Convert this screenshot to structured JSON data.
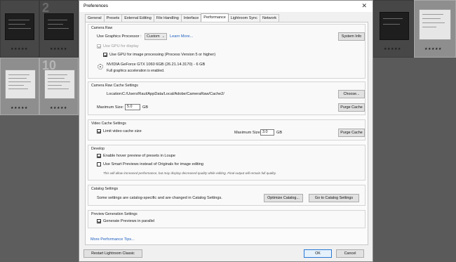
{
  "background": {
    "grid_numbers": [
      "2",
      "10"
    ],
    "stars": "★★★★★"
  },
  "dialog": {
    "title": "Preferences",
    "close_glyph": "✕",
    "tabs": [
      {
        "label": "General"
      },
      {
        "label": "Presets"
      },
      {
        "label": "External Editing"
      },
      {
        "label": "File Handling"
      },
      {
        "label": "Interface"
      },
      {
        "label": "Performance"
      },
      {
        "label": "Lightroom Sync"
      },
      {
        "label": "Network"
      }
    ],
    "active_tab": "Performance",
    "camera_raw": {
      "title": "Camera Raw",
      "gpu_label": "Use Graphics Processor :",
      "gpu_value": "Custom",
      "learn_more": "Learn More...",
      "system_info": "System Info",
      "gpu_display": "Use GPU for display",
      "gpu_display_checked": true,
      "gpu_image": "Use GPU for image processing (Process Version 5 or higher)",
      "gpu_image_checked": true,
      "gpu_name": "NVIDIA GeForce GTX 1060 6GB (26.21.14.3170) - 6 GB",
      "gpu_status": "Full graphics acceleration is enabled."
    },
    "cache": {
      "title": "Camera Raw Cache Settings",
      "location_label": "Location:",
      "location_value": "C:/Users/Raul/AppData/Local/Adobe/CameraRaw/Cache2/",
      "choose": "Choose...",
      "max_label": "Maximum Size:",
      "max_value": "5.0",
      "unit": "GB",
      "purge": "Purge Cache"
    },
    "video": {
      "title": "Video Cache Settings",
      "limit_label": "Limit video cache size",
      "limit_checked": true,
      "max_label": "Maximum Size:",
      "max_value": "3.0",
      "unit": "GB",
      "purge": "Purge Cache"
    },
    "develop": {
      "title": "Develop",
      "hover_label": "Enable hover preview of presets in Loupe",
      "hover_checked": true,
      "smart_label": "Use Smart Previews instead of Originals for image editing",
      "smart_checked": false,
      "note": "This will allow increased performance, but may display decreased quality while editing. Final output will remain full quality."
    },
    "catalog": {
      "title": "Catalog Settings",
      "text": "Some settings are catalog-specific and are changed in Catalog Settings.",
      "optimize": "Optimize Catalog...",
      "goto": "Go to Catalog Settings"
    },
    "preview": {
      "title": "Preview Generation Settings",
      "parallel_label": "Generate Previews in parallel",
      "parallel_checked": true
    },
    "more_tips": "More Performance Tips...",
    "restart": "Restart Lightroom Classic",
    "ok": "OK",
    "cancel": "Cancel"
  }
}
